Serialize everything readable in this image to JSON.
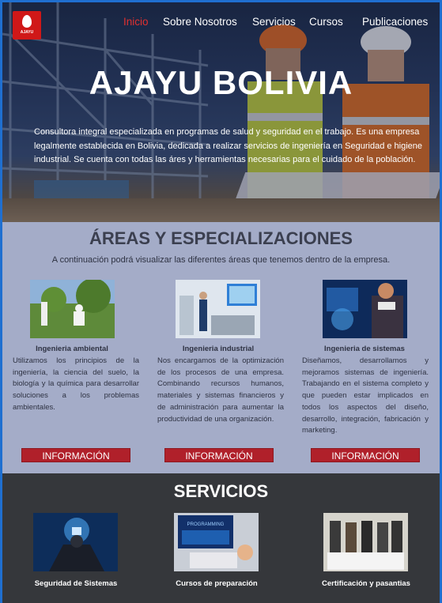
{
  "header": {
    "logo_text": "AJAYU",
    "nav": [
      {
        "label": "Inicio",
        "active": true
      },
      {
        "label": "Sobre Nosotros",
        "active": false
      },
      {
        "label": "Servicios",
        "active": false
      },
      {
        "label": "Cursos",
        "active": false
      },
      {
        "label": "Publicaciones",
        "active": false
      }
    ]
  },
  "hero": {
    "title": "AJAYU BOLIVIA",
    "description": "Consultora integral especializada en programas de salud y seguridad en el trabajo. Es una empresa legalmente establecida en Bolivia, dedicada a realizar servicios de ingeniería en Seguridad e higiene industrial. Se cuenta con todas las áres y herramientas necesarias para el cuidado de la población."
  },
  "areas": {
    "title": "ÁREAS Y ESPECIALIZACIONES",
    "subtitle": "A continuación podrá visualizar las diferentes áreas que tenemos dentro de la empresa.",
    "items": [
      {
        "name": "Ingenieria ambiental",
        "text": "Utilizamos los principios de la ingeniería, la ciencia del suelo, la biología y la química para desarrollar soluciones a los problemas ambientales.",
        "button": "INFORMACIÓN"
      },
      {
        "name": "Ingenieria industrial",
        "text": "Nos encargamos de la optimización de los procesos de una empresa. Combinando recursos humanos, materiales y sistemas financieros y de administración para aumentar la productividad de una organización.",
        "button": "INFORMACIÓN"
      },
      {
        "name": "Ingenieria de sistemas",
        "text": "Diseñamos, desarrollamos y mejoramos sistemas de ingeniería. Trabajando en el sistema completo y que pueden estar implicados en todos los aspectos del diseño, desarrollo, integración, fabricación y marketing.",
        "button": "INFORMACIÓN"
      }
    ]
  },
  "servicios": {
    "title": "SERVICIOS",
    "items": [
      {
        "label": "Seguridad de Sistemas"
      },
      {
        "label": "Cursos de preparación"
      },
      {
        "label": "Certificación y pasantias"
      }
    ],
    "screen_word": "PROGRAMMING"
  }
}
